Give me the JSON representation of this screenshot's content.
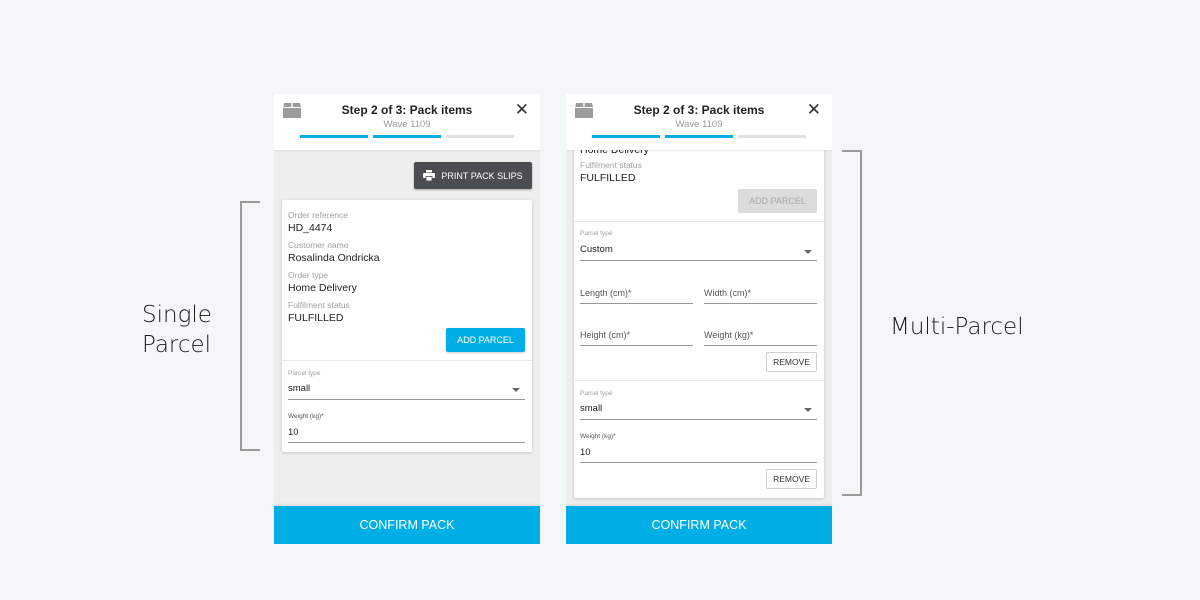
{
  "annotations": {
    "left_line1": "Single",
    "left_line2": "Parcel",
    "right": "Multi-Parcel"
  },
  "colors": {
    "accent": "#00aee6",
    "dark_button": "#4a4d52",
    "disabled_button": "#dcdcdc",
    "background": "#f4f7f8"
  },
  "screens": [
    {
      "header": {
        "title": "Step 2 of 3: Pack items",
        "subtitle": "Wave 1109",
        "close_icon": "close-icon",
        "box_icon": "package-icon"
      },
      "progress": {
        "current_step": 2,
        "total_steps": 3
      },
      "print_button": "PRINT PACK SLIPS",
      "order": {
        "ref_label": "Order reference",
        "ref_value": "HD_4474",
        "customer_label": "Customer name",
        "customer_value": "Rosalinda Ondricka",
        "type_label": "Order type",
        "type_value": "Home Delivery",
        "status_label": "Fulfilment status",
        "status_value": "FULFILLED"
      },
      "add_parcel": "ADD PARCEL",
      "parcels": [
        {
          "type_label": "Parcel type",
          "type_value": "small",
          "weight_label": "Weight (kg)*",
          "weight_value": "10"
        }
      ],
      "confirm": "CONFIRM PACK"
    },
    {
      "header": {
        "title": "Step 2 of 3: Pack items",
        "subtitle": "Wave 1109",
        "close_icon": "close-icon",
        "box_icon": "package-icon"
      },
      "progress": {
        "current_step": 2,
        "total_steps": 3
      },
      "order": {
        "type_value": "Home Delivery",
        "status_label": "Fulfilment status",
        "status_value": "FULFILLED"
      },
      "add_parcel": "ADD PARCEL",
      "parcels": [
        {
          "type_label": "Parcel type",
          "type_value": "Custom",
          "length_label": "Length (cm)*",
          "width_label": "Width (cm)*",
          "height_label": "Height (cm)*",
          "weight_label": "Weight (kg)*",
          "remove": "REMOVE"
        },
        {
          "type_label": "Parcel type",
          "type_value": "small",
          "weight_label": "Weight (kg)*",
          "weight_value": "10",
          "remove": "REMOVE"
        }
      ],
      "confirm": "CONFIRM PACK"
    }
  ]
}
